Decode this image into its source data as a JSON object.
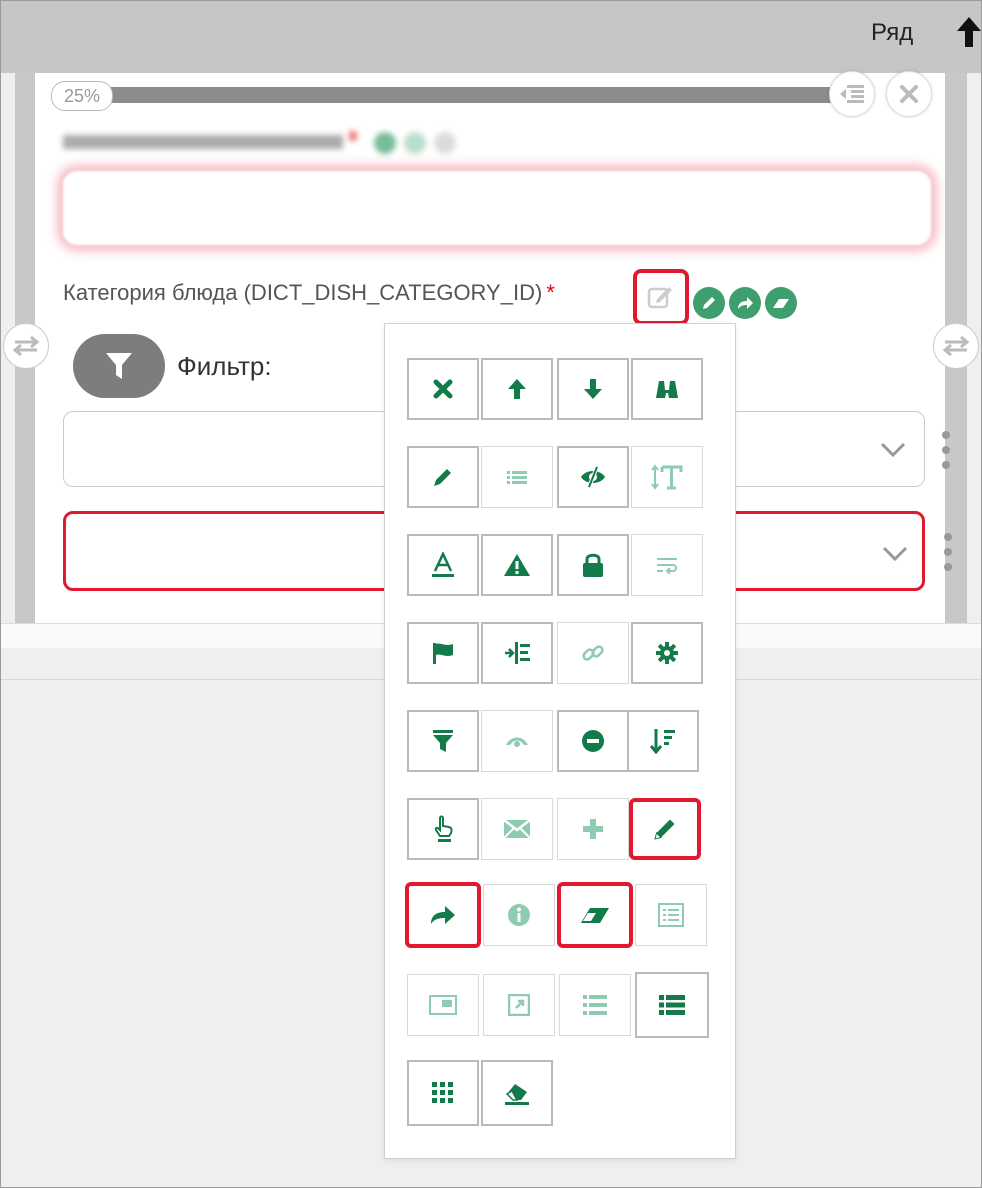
{
  "header": {
    "row_label": "Ряд"
  },
  "progress": {
    "label": "25%",
    "value_percent": 25
  },
  "field": {
    "label": "Категория блюда (DICT_DISH_CATEGORY_ID)",
    "required_mark": "*"
  },
  "filter": {
    "label": "Фильтр:"
  },
  "colors": {
    "accent_green": "#137a4a",
    "error_red": "#e0192f",
    "panel_gray": "#c6c6c6"
  },
  "toolbar_icons": [
    [
      "close-x-icon",
      "arrow-up-icon",
      "arrow-down-icon",
      "binoculars-icon"
    ],
    [
      "pencil-icon",
      "list-small-icon",
      "eye-slash-icon",
      "text-height-icon"
    ],
    [
      "font-underline-icon",
      "warning-icon",
      "lock-icon",
      "text-wrap-icon"
    ],
    [
      "flag-icon",
      "indent-icon",
      "link-icon",
      "gear-icon"
    ],
    [
      "funnel-icon",
      "eye-icon",
      "minus-circle-icon",
      "sort-desc-icon"
    ],
    [
      "hand-pointer-icon",
      "envelope-icon",
      "plus-icon",
      "pencil-icon"
    ],
    [
      "share-arrow-icon",
      "info-icon",
      "eraser-icon",
      "list-alt-icon"
    ],
    [
      "window-icon",
      "external-link-icon",
      "list-icon",
      "list-bold-icon"
    ],
    [
      "grid-dots-icon",
      "eraser-fill-icon"
    ]
  ]
}
